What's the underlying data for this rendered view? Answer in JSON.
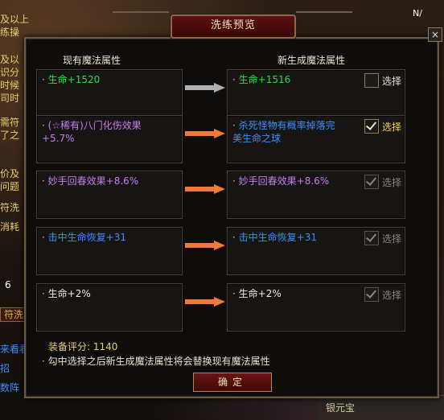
{
  "background": {
    "left_fragments": [
      "及以上",
      "练操",
      "及以",
      "识分",
      "时候",
      "司时",
      "",
      "需符",
      "了之",
      "",
      "价及",
      "问题",
      "符洗",
      "消耗"
    ],
    "number_six": "6",
    "button_fragment": "符洗",
    "link_fragments": [
      "来看看",
      "招",
      "数阵"
    ],
    "top_right": "N/",
    "bottom_label": "银元宝"
  },
  "dialog": {
    "title": "洗练预览",
    "close_label": "×",
    "left_header": "现有魔法属性",
    "right_header": "新生成魔法属性",
    "rows": [
      {
        "current": {
          "text": "生命+1520",
          "color": "green"
        },
        "new": {
          "text": "生命+1516",
          "color": "green"
        },
        "select": {
          "label": "选择",
          "checked": false,
          "enabled": true,
          "state": "normal"
        },
        "arrow": "grey"
      },
      {
        "current": {
          "text": "(☆稀有)八门化伤效果\n+5.7%",
          "color": "purple"
        },
        "new": {
          "text": "杀死怪物有概率掉落完\n美生命之球",
          "color": "blue"
        },
        "select": {
          "label": "选择",
          "checked": true,
          "enabled": true,
          "state": "on"
        },
        "arrow": "orange"
      },
      {
        "current": {
          "text": "妙手回春效果+8.6%",
          "color": "purple"
        },
        "new": {
          "text": "妙手回春效果+8.6%",
          "color": "purple"
        },
        "select": {
          "label": "选择",
          "checked": true,
          "enabled": false,
          "state": "off"
        },
        "arrow": "orange"
      },
      {
        "current": {
          "text": "击中生命恢复+31",
          "color": "blue"
        },
        "new": {
          "text": "击中生命恢复+31",
          "color": "blue"
        },
        "select": {
          "label": "选择",
          "checked": true,
          "enabled": false,
          "state": "off"
        },
        "arrow": "orange"
      },
      {
        "current": {
          "text": "生命+2%",
          "color": "white"
        },
        "new": {
          "text": "生命+2%",
          "color": "white"
        },
        "select": {
          "label": "选择",
          "checked": true,
          "enabled": false,
          "state": "off"
        },
        "arrow": "orange"
      }
    ],
    "rating_label": "装备评分:",
    "rating_value": "1140",
    "notice": "勾中选择之后新生成魔法属性将会替换现有魔法属性",
    "confirm_label": "确定"
  },
  "colors": {
    "green": "#27e040",
    "purple": "#c77cf0",
    "blue": "#3a8fff",
    "orange_arrow": "#f07a3a",
    "grey_arrow": "#b0b0b0",
    "title_red": "#5a1010"
  }
}
